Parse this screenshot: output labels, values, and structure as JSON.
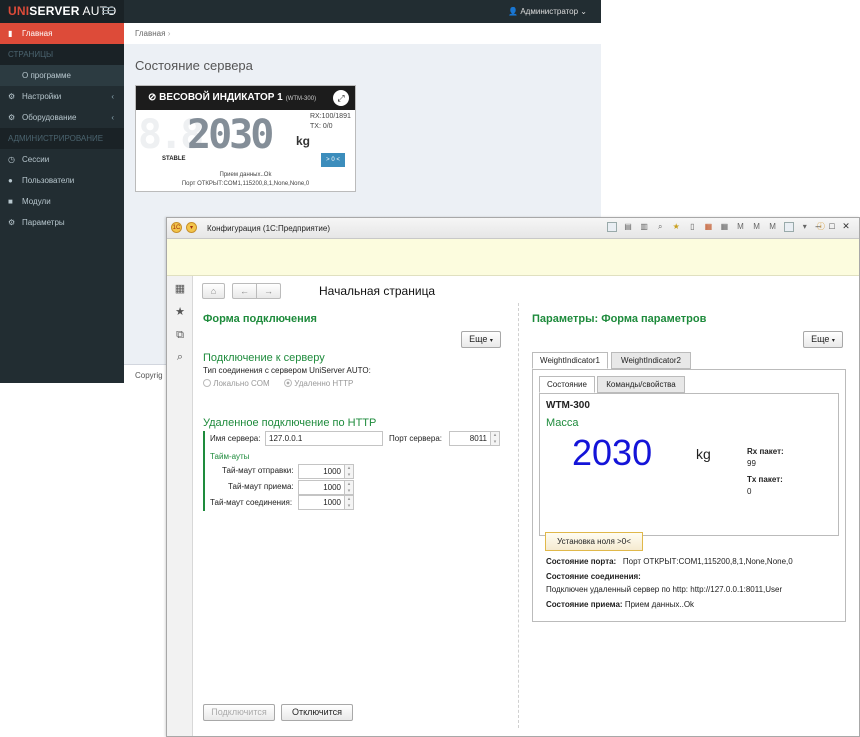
{
  "web": {
    "logo": {
      "part1": "UNI",
      "part2": "SERVER",
      "part3": " AUTO"
    },
    "user": "Администратор",
    "user_chevron": "⌄",
    "sidebar": {
      "home": "Главная",
      "pages_header": "СТРАНИЦЫ",
      "about": "О программе",
      "settings": "Настройки",
      "equipment": "Оборудование",
      "admin_header": "АДМИНИСТРИРОВАНИЕ",
      "sessions": "Сессии",
      "users": "Пользователи",
      "modules": "Модули",
      "parameters": "Параметры"
    },
    "breadcrumb": "Главная",
    "page_title": "Состояние сервера",
    "copyright": "Copyrig",
    "indicator": {
      "title": "ВЕСОВОЙ ИНДИКАТОР 1",
      "model": "(WTM-300)",
      "ghost": "8.8",
      "value": "2030",
      "unit": "kg",
      "rx": "RX:100/1891",
      "tx": "TX:       0/0",
      "stable": "STABLE",
      "zero_button": "> 0 <",
      "status1": "Прием данных..Ok",
      "status2": "Порт ОТКРЫТ:COM1,115200,8,1,None,None,0"
    }
  },
  "win": {
    "title": "Конфигурация  (1С:Предприятие)",
    "start_page_title": "Начальная страница",
    "left": {
      "form_title": "Форма подключения",
      "more_button": "Еще",
      "server_section": "Подключение к серверу",
      "conn_type_label": "Тип соединения с сервером UniServer AUTO:",
      "radio_local": "Локально COM",
      "radio_remote": "Удаленно HTTP",
      "http_section": "Удаленное подключение по HTTP",
      "server_name_label": "Имя сервера:",
      "server_name_value": "127.0.0.1",
      "port_label": "Порт сервера:",
      "port_value": "8011",
      "timeouts_label": "Тайм-ауты",
      "send_timeout_label": "Тай-маут отправки:",
      "send_timeout_value": "1000",
      "recv_timeout_label": "Тай-маут приема:",
      "recv_timeout_value": "1000",
      "conn_timeout_label": "Тай-маут соединения:",
      "conn_timeout_value": "1000",
      "connect_button": "Подключится",
      "disconnect_button": "Отключится"
    },
    "right": {
      "form_title": "Параметры: Форма параметров",
      "more_button": "Еще",
      "tab1": "WeightIndicator1",
      "tab2": "WeightIndicator2",
      "subtab1": "Состояние",
      "subtab2": "Команды/свойства",
      "model": "WTM-300",
      "mass_label": "Масса",
      "mass_value": "2030",
      "unit": "kg",
      "rx_label": "Rx пакет:",
      "rx_value": "99",
      "tx_label": "Tx пакет:",
      "tx_value": "0",
      "zero_button": "Установка ноля >0<",
      "port_state_label": "Состояние порта:",
      "port_state_value": "Порт ОТКРЫТ:COM1,115200,8,1,None,None,0",
      "conn_state_label": "Состояние соединения:",
      "conn_state_value": "Подключен удаленный сервер по http: http://127.0.0.1:8011,User",
      "recv_state_label": "Состояние приема:",
      "recv_state_value": "Прием данных..Ok"
    }
  },
  "colors": {
    "accent_red": "#dd4b39",
    "sidebar": "#222d32",
    "green": "#1e8b3c",
    "blue_value": "#1414d8"
  }
}
